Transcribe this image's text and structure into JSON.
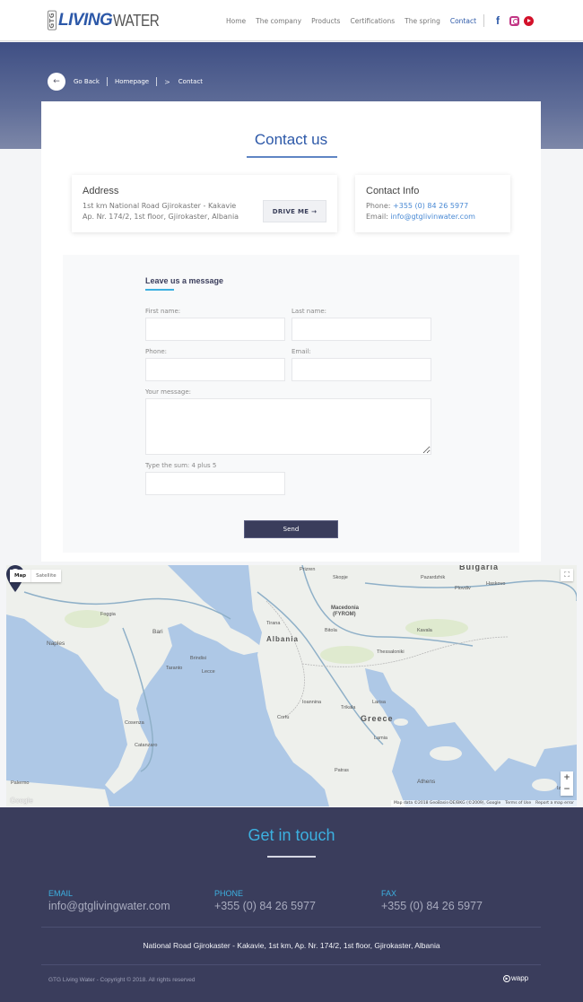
{
  "header": {
    "logo": {
      "prefix": "GTG",
      "living": "LIVING",
      "water": "WATER"
    },
    "nav": [
      {
        "label": "Home",
        "active": false
      },
      {
        "label": "The company",
        "active": false
      },
      {
        "label": "Products",
        "active": false
      },
      {
        "label": "Certifications",
        "active": false
      },
      {
        "label": "The spring",
        "active": false
      },
      {
        "label": "Contact",
        "active": true
      }
    ],
    "social": {
      "facebook": "f",
      "instagram": "instagram-icon",
      "youtube": "youtube-icon"
    }
  },
  "breadcrumb": {
    "back_icon": "←",
    "go_back": "Go Back",
    "homepage": "Homepage",
    "separator": ">",
    "current": "Contact"
  },
  "contact": {
    "title": "Contact us",
    "address": {
      "heading": "Address",
      "line1": "1st km National Road Gjirokaster - Kakavie",
      "line2": "Ap. Nr. 174/2, 1st floor, Gjirokaster, Albania",
      "drive_button": "DRIVE ME →"
    },
    "info": {
      "heading": "Contact Info",
      "phone_label": "Phone: ",
      "phone": "+355 (0) 84 26 5977",
      "email_label": "Email: ",
      "email": "info@gtglivinwater.com"
    }
  },
  "form": {
    "title": "Leave us a message",
    "first_name_label": "First name:",
    "first_name_value": "",
    "last_name_label": "Last name:",
    "last_name_value": "",
    "phone_label": "Phone:",
    "phone_value": "",
    "email_label": "Email:",
    "email_value": "",
    "message_label": "Your message:",
    "message_value": "",
    "sum_label": "Type the sum: 4 plus 5",
    "sum_value": "",
    "send_button": "Send"
  },
  "map": {
    "type_map": "Map",
    "type_satellite": "Satellite",
    "fullscreen_icon": "⛶",
    "zoom_in": "+",
    "zoom_out": "−",
    "google": "Google",
    "attribution": "Map data ©2018 GeoBasis-DE/BKG (©2009), Google",
    "terms": "Terms of Use",
    "report": "Report a map error",
    "labels": {
      "bulgaria": "Bulgaria",
      "macedonia": "Macedonia",
      "fyrom": "(FYROM)",
      "albania": "Albania",
      "greece": "Greece",
      "skopje": "Skopje",
      "tirana": "Tirana",
      "prizren": "Prizren",
      "plovdiv": "Plovdiv",
      "pazardzhik": "Pazardzhik",
      "haskovo": "Haskovo",
      "thessaloniki": "Thessaloniki",
      "ioannina": "Ioannina",
      "larisa": "Larisa",
      "trikala": "Trikala",
      "lamia": "Lamia",
      "patras": "Patras",
      "athens": "Athens",
      "izmir": "Izmir",
      "naples": "Naples",
      "bari": "Bari",
      "foggia": "Foggia",
      "taranto": "Taranto",
      "brindisi": "Brindisi",
      "lecce": "Lecce",
      "cosenza": "Cosenza",
      "catanzaro": "Catanzaro",
      "palermo": "Palermo",
      "corfu": "Corfu",
      "bitola": "Bitola",
      "kavala": "Kavala"
    }
  },
  "footer": {
    "title": "Get in touch",
    "email_label": "EMAIL",
    "email": "info@gtglivingwater.com",
    "phone_label": "PHONE",
    "phone": "+355 (0) 84 26 5977",
    "fax_label": "FAX",
    "fax": "+355 (0) 84 26 5977",
    "address": "National Road Gjirokaster - Kakavie, 1st km, Ap. Nr. 174/2, 1st floor, Gjirokaster, Albania",
    "copyright": "GTG Living Water - Copyright © 2018. All rights reserved",
    "brand": "wapp"
  },
  "colors": {
    "brand_blue": "#2c58a8",
    "accent_cyan": "#3cb0e0",
    "footer_bg": "#3a3d5c",
    "link_blue": "#4a8ad4"
  }
}
